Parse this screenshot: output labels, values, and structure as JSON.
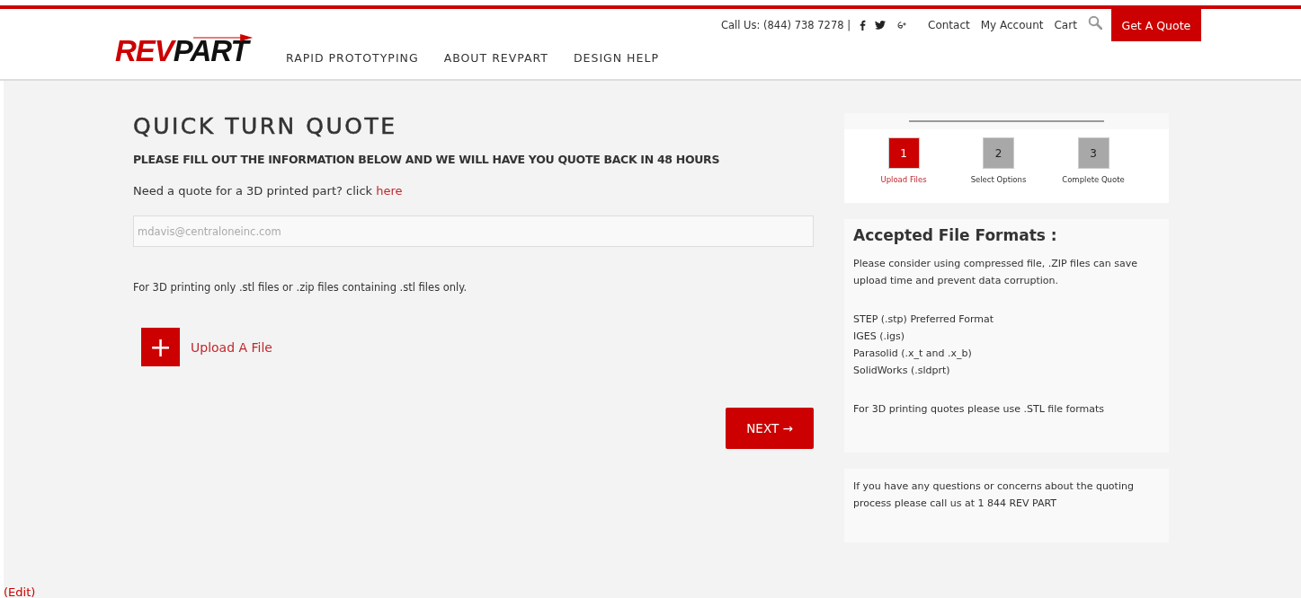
{
  "header": {
    "logo": {
      "part_1": "REV",
      "part_2": "PART"
    },
    "phone": "Call Us: (844) 738 7278 |",
    "links": [
      "Contact",
      "My Account",
      "Cart"
    ],
    "quote_button": "Get A Quote",
    "nav": [
      "RAPID PROTOTYPING",
      "ABOUT REVPART",
      "DESIGN HELP"
    ]
  },
  "main": {
    "title": "QUICK TURN QUOTE",
    "subtitle": "PLEASE FILL OUT THE INFORMATION BELOW AND WE WILL HAVE YOU QUOTE BACK IN 48 HOURS",
    "prompt": "Need a quote for a 3D printed part? click",
    "prompt_link": "here",
    "email": {
      "placeholder": "mdavis@centraloneinc.com"
    },
    "note": "For 3D printing only .stl files or .zip files containing .stl files only.",
    "upload_button": "+",
    "upload_label": "Upload A File",
    "next_button": "NEXT →"
  },
  "steps": [
    {
      "number": "1",
      "label": "Upload Files",
      "selected": true
    },
    {
      "number": "2",
      "label": "Select Options",
      "selected": false
    },
    {
      "number": "3",
      "label": "Complete Quote",
      "selected": false
    }
  ],
  "formats": {
    "title": "Accepted File Formats :",
    "intro": "Please consider using compressed file, .ZIP files can save upload time and prevent data corruption.",
    "list": [
      "STEP (.stp) Preferred Format",
      "IGES (.igs)",
      "Parasolid (.x_t and .x_b)",
      "SolidWorks (.sldprt)"
    ],
    "stl_note": "For 3D printing quotes please use .STL file formats"
  },
  "help": "If you have any questions or concerns about the quoting process please call us at 1 844 REV PART",
  "edit_link": "(Edit)"
}
